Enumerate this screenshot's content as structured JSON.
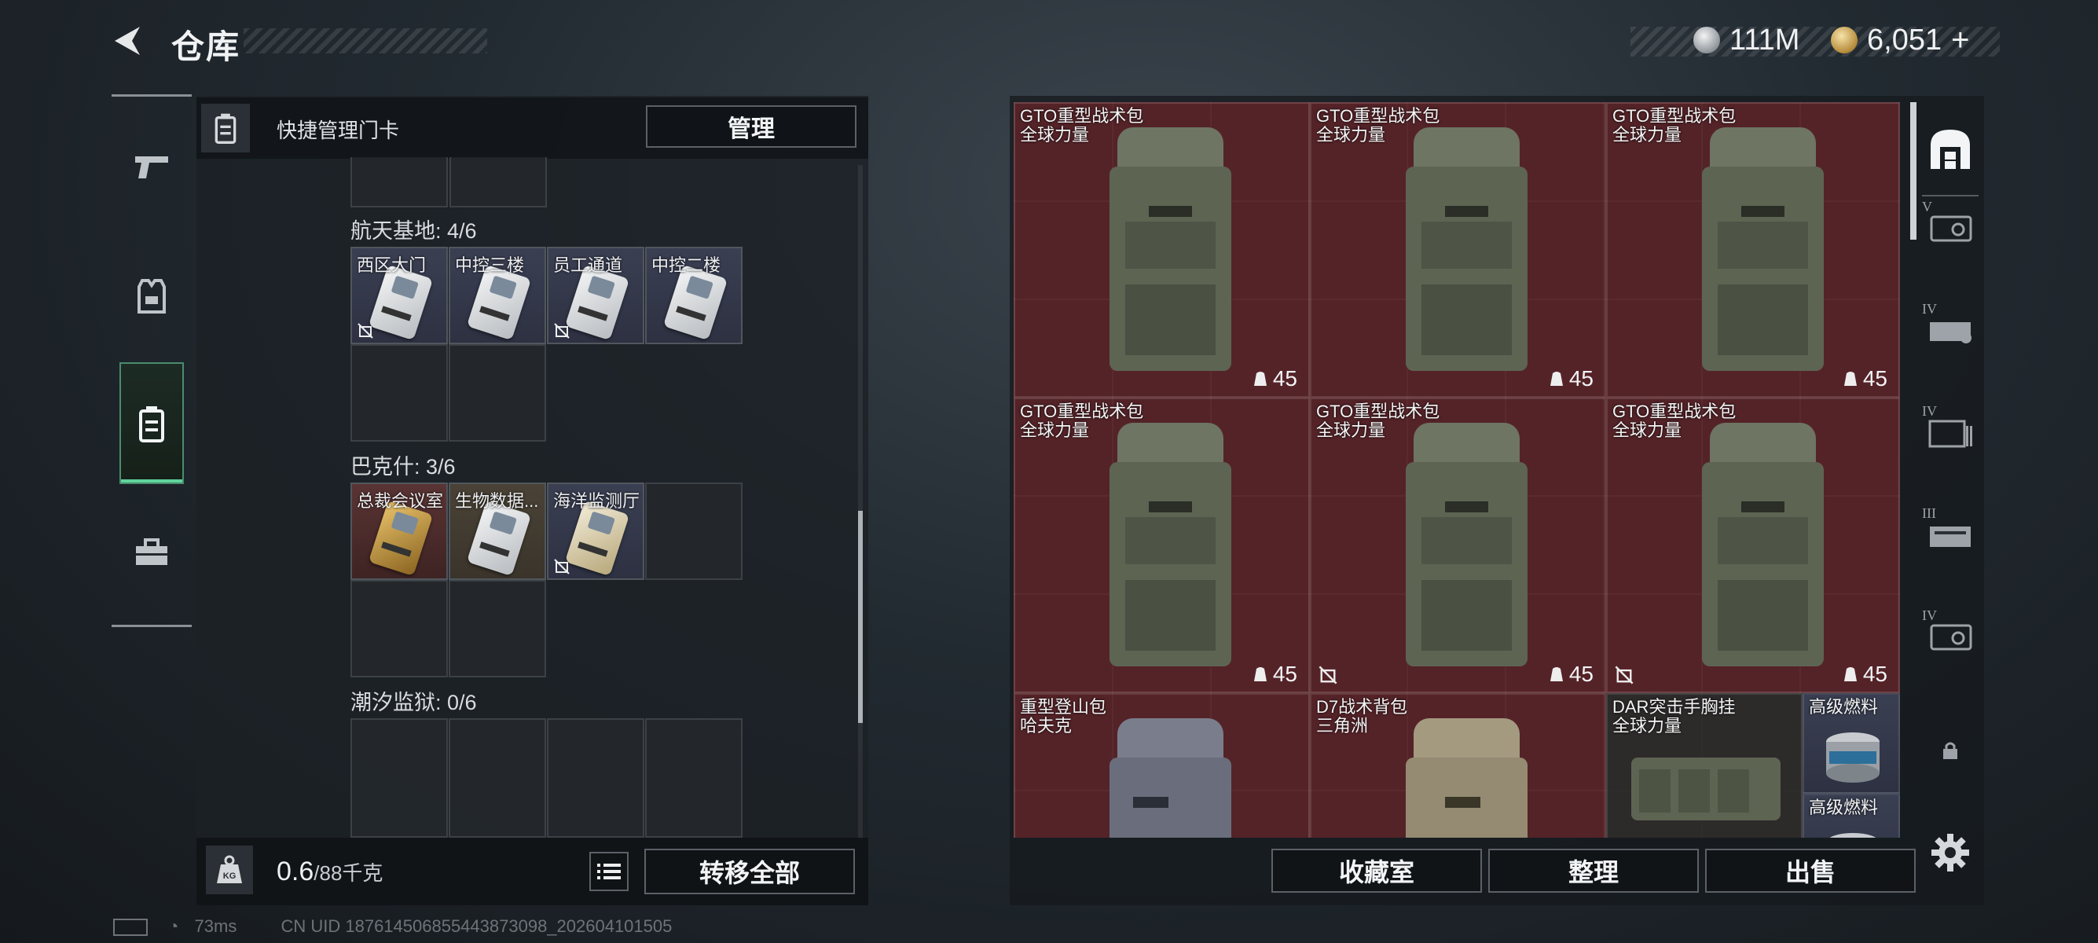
{
  "header": {
    "title": "仓库",
    "currency_silver": "111M",
    "currency_gold": "6,051",
    "add_symbol": "+"
  },
  "left_nav": {
    "items": [
      {
        "icon": "pistol-icon"
      },
      {
        "icon": "armor-vest-icon"
      },
      {
        "icon": "keycard-holder-icon"
      },
      {
        "icon": "toolbox-icon"
      }
    ],
    "active_index": 2
  },
  "keycard_panel": {
    "quick_manage_label": "快捷管理门卡",
    "manage_button": "管理",
    "groups": [
      {
        "title": "航天基地: 4/6",
        "slots": [
          {
            "label": "西区大门",
            "locked": true
          },
          {
            "label": "中控三楼",
            "locked": false
          },
          {
            "label": "员工通道",
            "locked": true
          },
          {
            "label": "中控二楼",
            "locked": false
          }
        ]
      },
      {
        "title": "巴克什: 3/6",
        "slots": [
          {
            "label": "总裁会议室",
            "locked": false
          },
          {
            "label": "生物数据...",
            "locked": false
          },
          {
            "label": "海洋监测厅",
            "locked": true
          }
        ]
      },
      {
        "title": "潮汐监狱: 0/6",
        "slots": []
      }
    ],
    "weight_value": "0.6",
    "weight_capacity": "/88千克",
    "transfer_all_button": "转移全部",
    "weight_icon_text": "KG"
  },
  "inventory": {
    "items": [
      {
        "name": "GTO重型战术包",
        "sub": "全球力量",
        "count": "45",
        "locked": false,
        "color": "#6e7562"
      },
      {
        "name": "GTO重型战术包",
        "sub": "全球力量",
        "count": "45",
        "locked": false,
        "color": "#6e7562"
      },
      {
        "name": "GTO重型战术包",
        "sub": "全球力量",
        "count": "45",
        "locked": false,
        "color": "#6e7562"
      },
      {
        "name": "GTO重型战术包",
        "sub": "全球力量",
        "count": "45",
        "locked": false,
        "color": "#6e7562"
      },
      {
        "name": "GTO重型战术包",
        "sub": "全球力量",
        "count": "45",
        "locked": true,
        "color": "#6e7562"
      },
      {
        "name": "GTO重型战术包",
        "sub": "全球力量",
        "count": "45",
        "locked": true,
        "color": "#6e7562"
      },
      {
        "name": "重型登山包",
        "sub": "哈夫克",
        "color": "#7a7e8c"
      },
      {
        "name": "D7战术背包",
        "sub": "三角洲",
        "color": "#a49a80"
      },
      {
        "name": "DAR突击手胸挂",
        "sub": "全球力量",
        "color": "#5e6452"
      },
      {
        "name": "高级燃料",
        "sub": ""
      },
      {
        "name": "高级燃料",
        "sub": ""
      }
    ],
    "collection_button": "收藏室",
    "organize_button": "整理",
    "sell_button": "出售"
  },
  "right_nav": {
    "items": [
      {
        "icon": "warehouse-icon",
        "tier": ""
      },
      {
        "icon": "safe-case-icon",
        "tier": "V"
      },
      {
        "icon": "supply-box-icon",
        "tier": "IV"
      },
      {
        "icon": "file-cabinet-icon",
        "tier": "IV"
      },
      {
        "icon": "crate-icon",
        "tier": "III"
      },
      {
        "icon": "safe-case-icon",
        "tier": "IV"
      },
      {
        "icon": "lock-icon",
        "tier": ""
      }
    ]
  },
  "status_bar": {
    "ping": "73ms",
    "uid": "CN UID 1876145068554438730​98_202604101505"
  },
  "colors": {
    "active_green": "#5fd49b",
    "item_red_bg": "#4a2226"
  }
}
